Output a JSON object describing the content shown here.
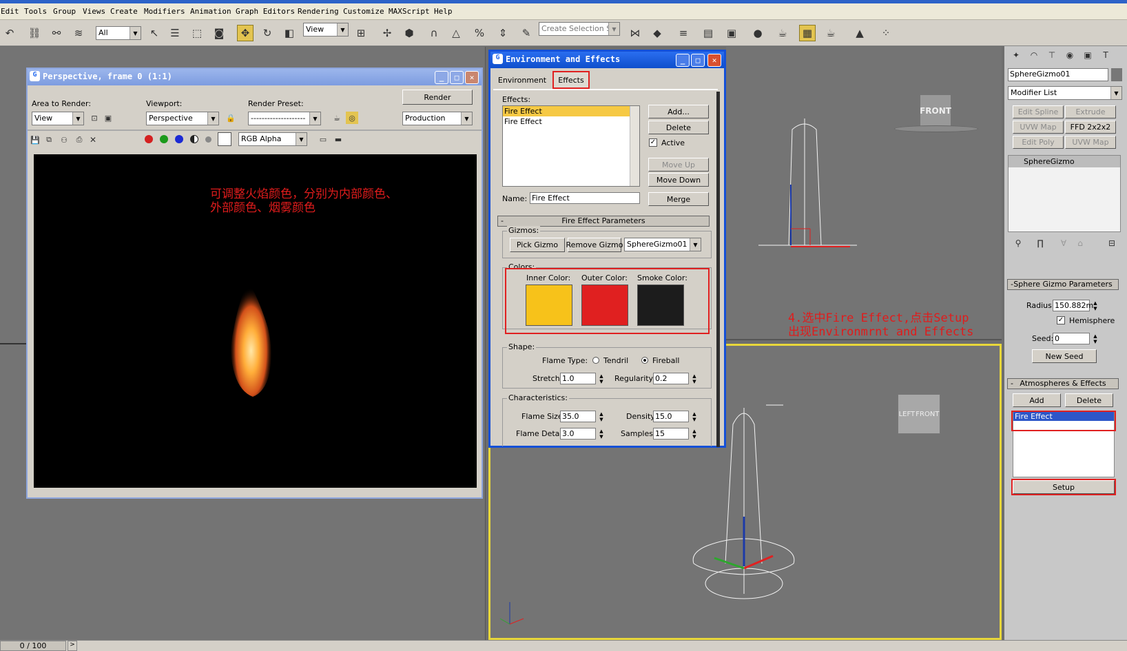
{
  "menu": [
    "Edit",
    "Tools",
    "Group",
    "Views",
    "Create",
    "Modifiers",
    "Animation",
    "Graph Editors",
    "Rendering",
    "Customize",
    "MAXScript",
    "Help"
  ],
  "toolbar": {
    "filter_value": "All",
    "refcoord_value": "View",
    "selection_set_placeholder": "Create Selection Set"
  },
  "render_window": {
    "title": "Perspective, frame 0 (1:1)",
    "area_label": "Area to Render:",
    "area_value": "View",
    "viewport_label": "Viewport:",
    "viewport_value": "Perspective",
    "preset_label": "Render Preset:",
    "preset_value": "--------------------",
    "render_button": "Render",
    "production_value": "Production",
    "channel_value": "RGB Alpha",
    "annotation": "可调整火焰颜色，分别为内部颜色、\n外部颜色、烟雾颜色"
  },
  "env_dialog": {
    "title": "Environment and Effects",
    "tabs": [
      "Environment",
      "Effects"
    ],
    "effects_label": "Effects:",
    "effects_list": [
      "Fire Effect",
      "Fire Effect"
    ],
    "buttons": {
      "add": "Add...",
      "delete": "Delete",
      "active": "Active",
      "move_up": "Move Up",
      "move_down": "Move Down",
      "merge": "Merge"
    },
    "name_label": "Name:",
    "name_value": "Fire Effect",
    "rollout_title": "Fire Effect Parameters",
    "gizmos_label": "Gizmos:",
    "pick_gizmo": "Pick Gizmo",
    "remove_gizmo": "Remove Gizmo",
    "gizmo_value": "SphereGizmo01",
    "colors_label": "Colors:",
    "inner_color_label": "Inner Color:",
    "outer_color_label": "Outer Color:",
    "smoke_color_label": "Smoke Color:",
    "inner_color": "#f7c21a",
    "outer_color": "#e02020",
    "smoke_color": "#1c1c1c",
    "shape_label": "Shape:",
    "flame_type_label": "Flame Type:",
    "tendril": "Tendril",
    "fireball": "Fireball",
    "stretch_label": "Stretch:",
    "stretch_value": "1.0",
    "regularity_label": "Regularity:",
    "regularity_value": "0.2",
    "characteristics_label": "Characteristics:",
    "flame_size_label": "Flame Size:",
    "flame_size_value": "35.0",
    "density_label": "Density:",
    "density_value": "15.0",
    "flame_detail_label": "Flame Detail:",
    "flame_detail_value": "3.0",
    "samples_label": "Samples:",
    "samples_value": "15"
  },
  "viewports": {
    "front_cube": "FRONT",
    "left_face": "LEFT",
    "front_face": "FRONT"
  },
  "step_annotation": "4.选中Fire Effect,点击Setup\n出现Environmrnt and Effects",
  "command_panel": {
    "object_name": "SphereGizmo01",
    "modifier_list": "Modifier List",
    "modifier_buttons": [
      "Edit Spline",
      "Extrude",
      "UVW Map",
      "FFD 2x2x2",
      "Edit Poly",
      "UVW Map"
    ],
    "stack_item": "SphereGizmo",
    "sphere_rollout": "Sphere Gizmo Parameters",
    "radius_label": "Radius:",
    "radius_value": "150.882m",
    "hemisphere": "Hemisphere",
    "seed_label": "Seed:",
    "seed_value": "0",
    "new_seed": "New Seed",
    "atm_rollout": "Atmospheres & Effects",
    "add": "Add",
    "delete": "Delete",
    "atm_item": "Fire Effect",
    "setup": "Setup"
  },
  "status": {
    "frame": "0 / 100"
  }
}
